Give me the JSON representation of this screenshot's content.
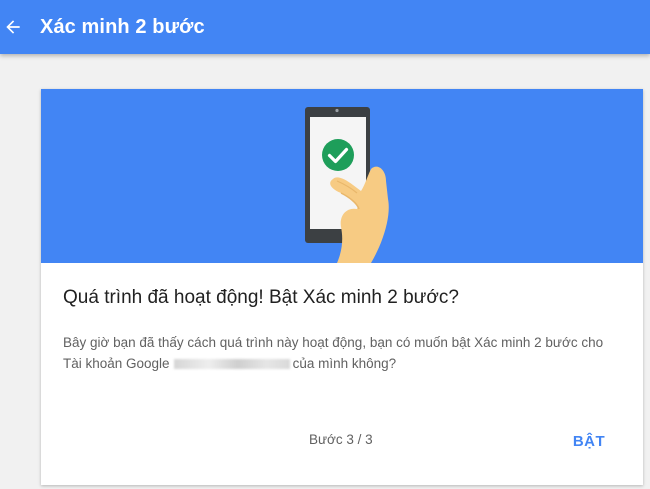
{
  "appbar": {
    "title": "Xác minh 2 bước",
    "back_icon": "arrow-back-icon"
  },
  "card": {
    "illustration_icons": [
      "smartphone-icon",
      "check-circle-icon",
      "hand-icon"
    ],
    "title": "Quá trình đã hoạt động! Bật Xác minh 2 bước?",
    "body_part1": "Bây giờ bạn đã thấy cách quá trình này hoạt động, bạn có muốn bật Xác minh 2 bước cho Tài khoản Google",
    "body_part2": "của mình không?",
    "step_label": "Bước 3 / 3",
    "enable_label": "BẬT"
  },
  "colors": {
    "primary": "#4285f4",
    "check": "#1e9e5a",
    "background": "#f1f1f1"
  }
}
